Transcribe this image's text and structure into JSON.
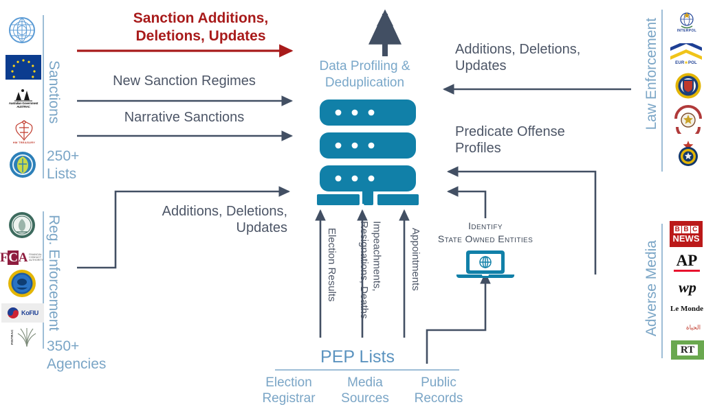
{
  "diagram": {
    "title_red": "Sanction Additions,\nDeletions, Updates",
    "hub": {
      "title": "Data Profiling &\nDeduplication",
      "icon": "database-server-icon",
      "color": "#1180a8",
      "output_arrow": "up-arrow-icon"
    },
    "left_flows": [
      {
        "label": "New Sanction Regimes",
        "arrow": "right-arrow-icon"
      },
      {
        "label": "Narrative Sanctions",
        "arrow": "right-arrow-icon"
      },
      {
        "label": "Additions, Deletions,\nUpdates",
        "arrow": "right-arrow-icon"
      }
    ],
    "right_flows": [
      {
        "label": "Additions, Deletions,\nUpdates",
        "arrow": "left-arrow-icon"
      },
      {
        "label": "Predicate Offense\nProfiles",
        "arrow": "left-arrow-icon"
      }
    ],
    "bottom_flows": [
      {
        "label": "Election Results",
        "arrow": "up-arrow-icon"
      },
      {
        "label": "Impeachments,\nResignations, Deaths",
        "arrow": "up-arrow-icon"
      },
      {
        "label": "Appointments",
        "arrow": "up-arrow-icon"
      }
    ],
    "soe": {
      "label": "Identify\nState Owned Entities",
      "icon": "laptop-globe-icon"
    },
    "pep": {
      "title": "PEP Lists",
      "sources": [
        "Election\nRegistrar",
        "Media\nSources",
        "Public\nRecords"
      ]
    },
    "groups": [
      {
        "id": "sanctions",
        "label": "Sanctions",
        "count": "250+\nLists",
        "side": "left",
        "logos": [
          {
            "name": "un-logo",
            "text": "UN"
          },
          {
            "name": "eu-flag-logo",
            "text": "EU"
          },
          {
            "name": "austrac-australian-government-logo",
            "text": "Australian Government\nAUSTRAC"
          },
          {
            "name": "hm-treasury-logo",
            "text": "HM TREASURY"
          },
          {
            "name": "swiss-seco-logo",
            "text": "SECO"
          }
        ]
      },
      {
        "id": "reg-enforcement",
        "label": "Reg. Enforcement",
        "count": "350+\nAgencies",
        "side": "left",
        "logos": [
          {
            "name": "us-treasury-ofac-logo",
            "text": "OFAC"
          },
          {
            "name": "fca-financial-conduct-authority-logo",
            "text": "FCA"
          },
          {
            "name": "finra-seal-logo",
            "text": "SEAL"
          },
          {
            "name": "kofiu-logo",
            "text": "KoFIU"
          },
          {
            "name": "fintrac-logo",
            "text": "FINTRAC"
          }
        ]
      },
      {
        "id": "law-enforcement",
        "label": "Law Enforcement",
        "count": "",
        "side": "right",
        "logos": [
          {
            "name": "interpol-logo",
            "text": "INTERPOL"
          },
          {
            "name": "europol-logo",
            "text": "EUROPOL"
          },
          {
            "name": "fbi-seal-logo",
            "text": "FBI"
          },
          {
            "name": "police-crest-logo",
            "text": "POLICE"
          },
          {
            "name": "national-police-crest-logo",
            "text": "POLRI"
          }
        ]
      },
      {
        "id": "adverse-media",
        "label": "Adverse Media",
        "count": "",
        "side": "right",
        "logos": [
          {
            "name": "bbc-news-logo",
            "text": "BBC NEWS"
          },
          {
            "name": "associated-press-logo",
            "text": "AP"
          },
          {
            "name": "washington-post-logo",
            "text": "wp"
          },
          {
            "name": "le-monde-logo",
            "text": "Le Monde"
          },
          {
            "name": "al-hayat-logo",
            "text": "Al Hayat"
          },
          {
            "name": "rt-logo",
            "text": "RT"
          }
        ]
      }
    ],
    "colors": {
      "accent_red": "#A81B1B",
      "arrow_navy": "#424f63",
      "teal": "#1180a8",
      "label_blue": "#7aa5c6",
      "text_gray": "#4c5566"
    }
  }
}
